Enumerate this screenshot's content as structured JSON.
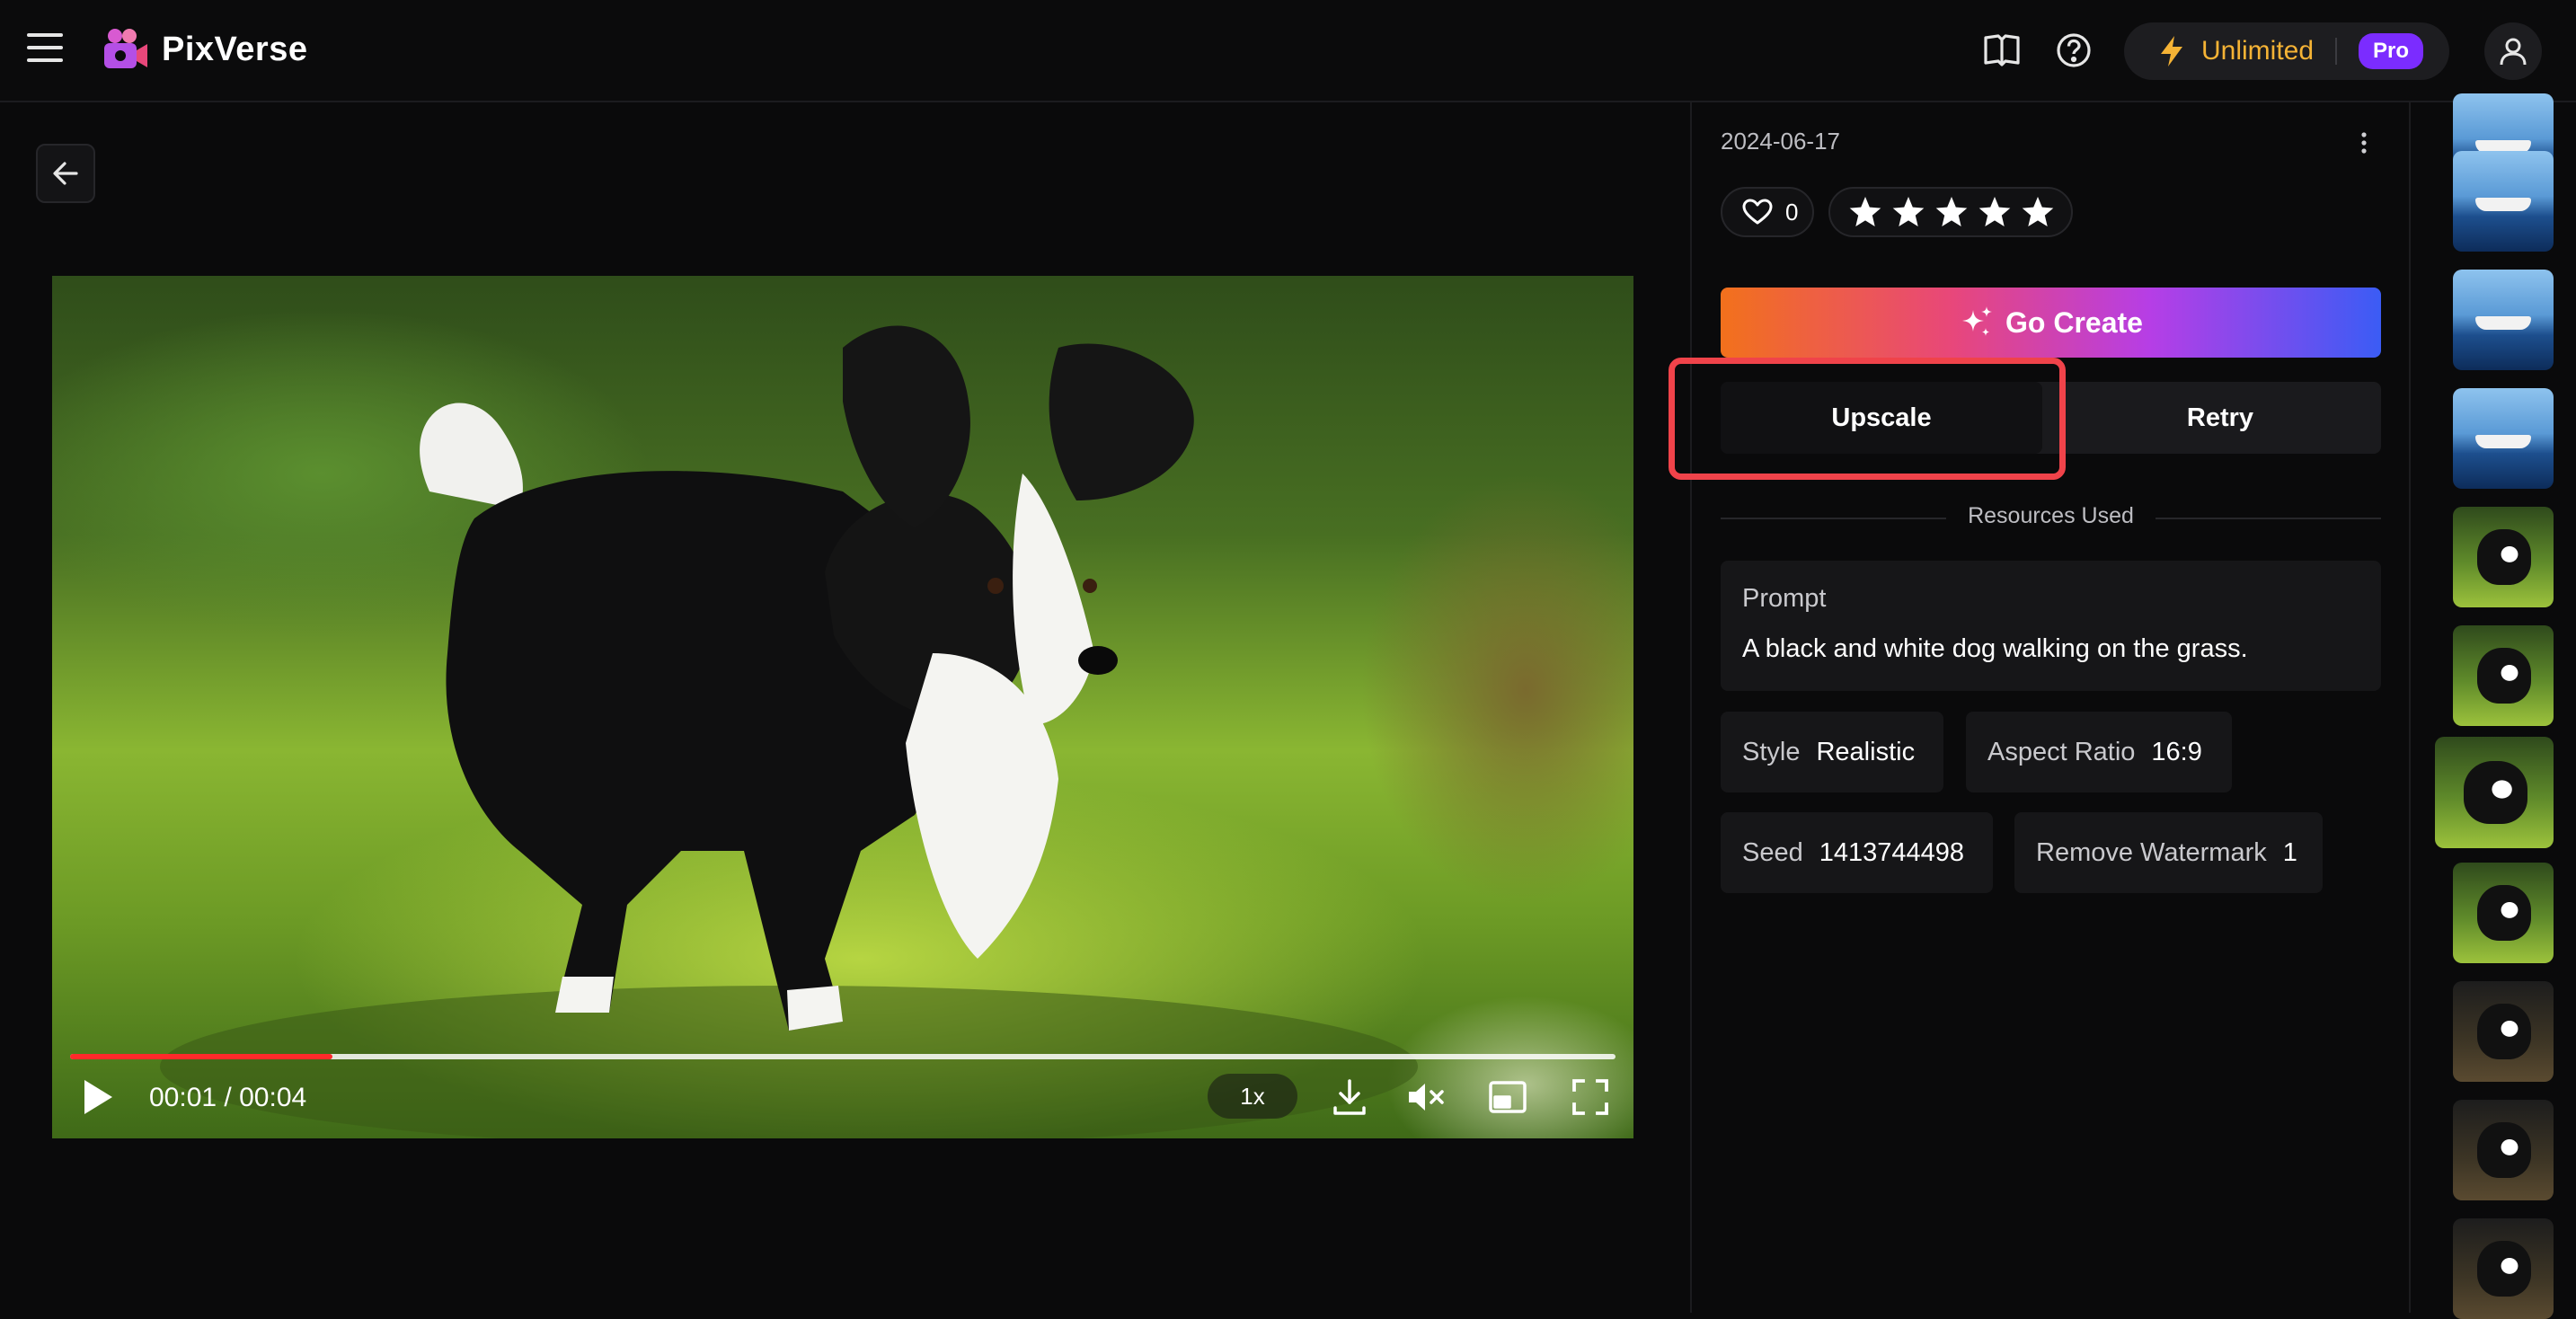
{
  "app": {
    "name": "PixVerse"
  },
  "header": {
    "plan_label": "Unlimited",
    "plan_badge": "Pro"
  },
  "player": {
    "current_time": "00:01",
    "separator": "/",
    "duration": "00:04",
    "speed": "1x",
    "progress": 0.17
  },
  "detail": {
    "date": "2024-06-17",
    "likes": "0",
    "stars": 5,
    "go_create_label": "Go Create",
    "upscale_label": "Upscale",
    "retry_label": "Retry",
    "resources_label": "Resources Used",
    "prompt_title": "Prompt",
    "prompt_text": "A black and white dog walking on the grass.",
    "style_key": "Style",
    "style_value": "Realistic",
    "aspect_key": "Aspect Ratio",
    "aspect_value": "16:9",
    "seed_key": "Seed",
    "seed_value": "1413744498",
    "watermark_key": "Remove Watermark",
    "watermark_value": "1"
  },
  "colors": {
    "accent_red": "#f0434a",
    "plan_gold": "#f5b335",
    "pro_purple": "#7b2cff",
    "progress_red": "#ff2a2a"
  },
  "thumbnails": [
    {
      "kind": "ship"
    },
    {
      "kind": "ship"
    },
    {
      "kind": "ship"
    },
    {
      "kind": "ship"
    },
    {
      "kind": "dog"
    },
    {
      "kind": "dog"
    },
    {
      "kind": "dog",
      "active": true
    },
    {
      "kind": "dog"
    },
    {
      "kind": "dog-dark"
    },
    {
      "kind": "dog-dark"
    },
    {
      "kind": "dog-dark"
    }
  ]
}
